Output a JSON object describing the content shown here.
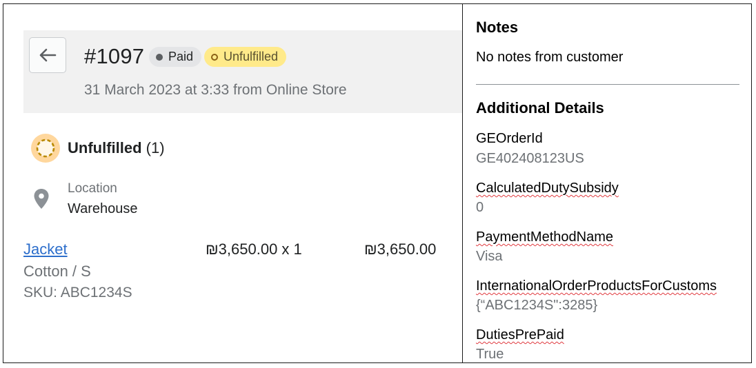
{
  "order": {
    "number": "#1097",
    "payment_status": "Paid",
    "fulfillment_status": "Unfulfilled",
    "date_line": "31 March 2023 at 3:33 from Online Store"
  },
  "fulfillment": {
    "title": "Unfulfilled",
    "count": "(1)",
    "location_label": "Location",
    "location_value": "Warehouse"
  },
  "line_item": {
    "name": "Jacket",
    "variant": "Cotton / S",
    "sku": "SKU: ABC1234S",
    "unit_price": "₪3,650.00 x 1",
    "total": "₪3,650.00"
  },
  "notes": {
    "title": "Notes",
    "text": "No notes from customer"
  },
  "additional": {
    "title": "Additional Details",
    "items": [
      {
        "key": "GEOrderId",
        "value": "GE402408123US"
      },
      {
        "key": "CalculatedDutySubsidy",
        "value": "0"
      },
      {
        "key": "PaymentMethodName",
        "value": "Visa"
      },
      {
        "key": "InternationalOrderProductsForCustoms",
        "value": "{“ABC1234S\":3285}"
      },
      {
        "key": "DutiesPrePaid",
        "value": "True"
      }
    ]
  },
  "icons": {
    "back": "arrow-left-icon",
    "status": "unfulfilled-circle-icon",
    "location": "location-pin-icon"
  },
  "colors": {
    "link": "#2c6ecb",
    "badge_paid_bg": "#e4e5e7",
    "badge_unfulfilled_bg": "#ffea8a",
    "spellcheck_underline": "#e0393e"
  }
}
